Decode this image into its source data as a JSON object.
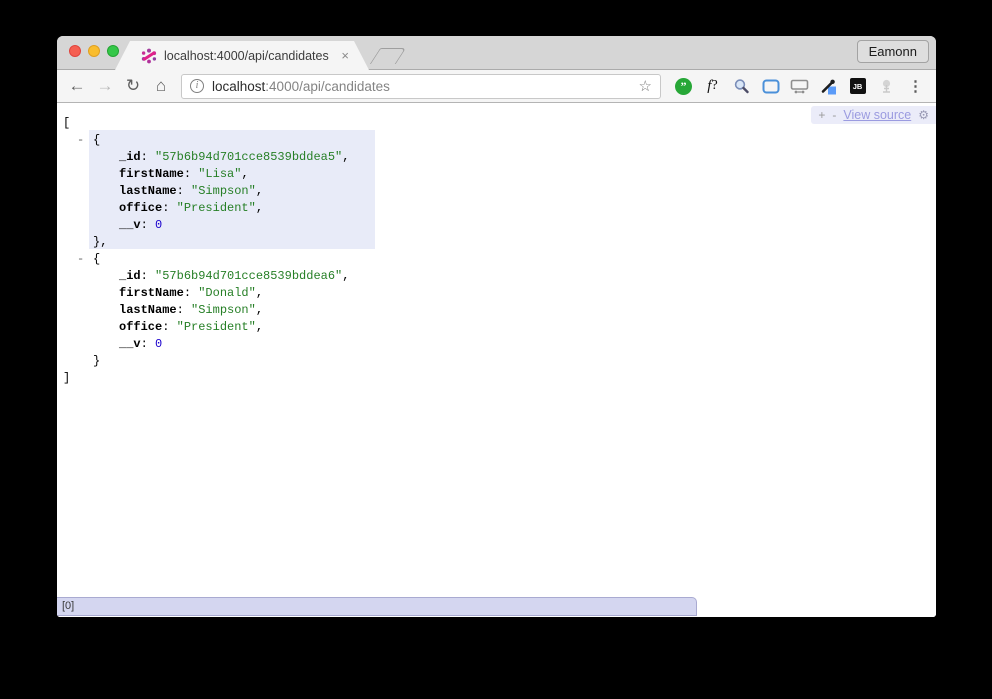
{
  "chrome": {
    "tab": {
      "title": "localhost:4000/api/candidates",
      "close_glyph": "×"
    },
    "profile_button_label": "Eamonn",
    "nav": {
      "back_glyph": "←",
      "forward_glyph": "→",
      "reload_glyph": "↻",
      "home_glyph": "⌂"
    },
    "omnibox": {
      "info_glyph": "i",
      "host": "localhost",
      "path_rest": ":4000/api/candidates",
      "bookmark_star_glyph": "☆"
    },
    "extensions": {
      "hangouts_glyph": "”",
      "font_question_glyph_f": "f",
      "font_question_glyph_q": "?",
      "jetbrains_glyph": "JB"
    },
    "menu_glyph": "⋮"
  },
  "json_viewer": {
    "controls": {
      "expand_all": "+",
      "collapse_all": "-",
      "view_source_label": "View source",
      "gear_glyph": "⚙"
    },
    "status_path": "[0]",
    "colors": {
      "key": "#000000",
      "string": "#267f26",
      "number": "#1a01cc",
      "highlight": "#e8ebf8",
      "status_bg": "#d4d6f0"
    },
    "rows": [
      {
        "kind": "bracket",
        "text": "["
      },
      {
        "kind": "open",
        "collapser": "-",
        "brace": "{"
      },
      {
        "kind": "prop",
        "key": "_id",
        "sep": ": ",
        "value": "\"57b6b94d701cce8539bddea5\"",
        "vtype": "string",
        "comma": ","
      },
      {
        "kind": "prop",
        "key": "firstName",
        "sep": ": ",
        "value": "\"Lisa\"",
        "vtype": "string",
        "comma": ","
      },
      {
        "kind": "prop",
        "key": "lastName",
        "sep": ": ",
        "value": "\"Simpson\"",
        "vtype": "string",
        "comma": ","
      },
      {
        "kind": "prop",
        "key": "office",
        "sep": ": ",
        "value": "\"President\"",
        "vtype": "string",
        "comma": ","
      },
      {
        "kind": "prop",
        "key": "__v",
        "sep": ": ",
        "value": "0",
        "vtype": "number",
        "comma": ""
      },
      {
        "kind": "close",
        "brace": "}",
        "comma": ","
      },
      {
        "kind": "open",
        "collapser": "-",
        "brace": "{"
      },
      {
        "kind": "prop",
        "key": "_id",
        "sep": ": ",
        "value": "\"57b6b94d701cce8539bddea6\"",
        "vtype": "string",
        "comma": ","
      },
      {
        "kind": "prop",
        "key": "firstName",
        "sep": ": ",
        "value": "\"Donald\"",
        "vtype": "string",
        "comma": ","
      },
      {
        "kind": "prop",
        "key": "lastName",
        "sep": ": ",
        "value": "\"Simpson\"",
        "vtype": "string",
        "comma": ","
      },
      {
        "kind": "prop",
        "key": "office",
        "sep": ": ",
        "value": "\"President\"",
        "vtype": "string",
        "comma": ","
      },
      {
        "kind": "prop",
        "key": "__v",
        "sep": ": ",
        "value": "0",
        "vtype": "number",
        "comma": ""
      },
      {
        "kind": "close",
        "brace": "}",
        "comma": ""
      },
      {
        "kind": "bracket",
        "text": "]"
      }
    ]
  }
}
